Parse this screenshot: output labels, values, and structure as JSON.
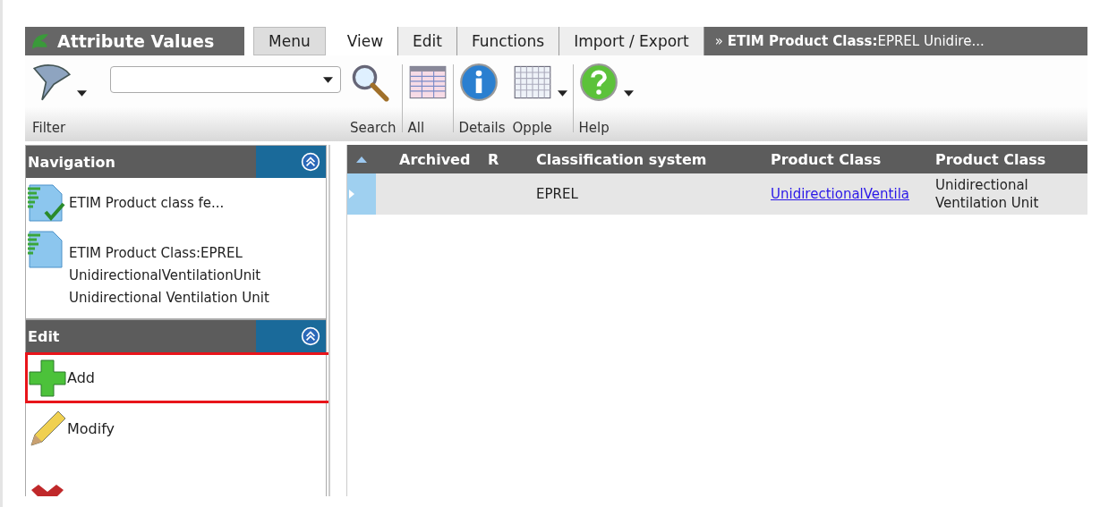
{
  "app_title": "Attribute Values",
  "tabs": [
    {
      "label": "Menu",
      "selected": false,
      "kind": "menu"
    },
    {
      "label": "View",
      "selected": true,
      "kind": "tab"
    },
    {
      "label": "Edit",
      "selected": false,
      "kind": "tab"
    },
    {
      "label": "Functions",
      "selected": false,
      "kind": "tab"
    },
    {
      "label": "Import / Export",
      "selected": false,
      "kind": "tab"
    }
  ],
  "breadcrumb": "» **ETIM Product Class:**EPREL Unidire...",
  "toolbar": [
    {
      "kind": "button",
      "label": "Filter",
      "dropdown": true
    },
    {
      "kind": "combo"
    },
    {
      "kind": "button",
      "label": "Search",
      "dropdown": false
    },
    {
      "kind": "button",
      "label": "All",
      "dropdown": false
    },
    {
      "kind": "button",
      "label": "Details",
      "dropdown": false
    },
    {
      "kind": "button",
      "label": "Opple",
      "dropdown": true
    },
    {
      "kind": "button",
      "label": "Help",
      "dropdown": true
    }
  ],
  "navigation": {
    "title": "Navigation",
    "expanded": true,
    "items": [
      {
        "lines": [
          "ETIM Product class fe..."
        ]
      },
      {
        "lines": [
          "ETIM Product Class:EPREL",
          "UnidirectionalVentilationUnit",
          "Unidirectional Ventilation Unit"
        ]
      }
    ]
  },
  "edit_panel": {
    "title": "Edit",
    "expanded": true,
    "items": [
      {
        "label": "Add",
        "highlighted": true
      },
      {
        "label": "Modify",
        "highlighted": false
      },
      {
        "highlighted": false
      }
    ]
  },
  "table": {
    "columns": [
      "Archived",
      "R",
      "Classification system",
      "Product Class",
      "Product Class"
    ],
    "rows": [
      {
        "selected": true,
        "cells": [
          {
            "kind": "text"
          },
          {
            "kind": "text"
          },
          {
            "text": "EPREL",
            "kind": "text"
          },
          {
            "text": "UnidirectionalVentila",
            "kind": "link"
          },
          {
            "text": "Unidirectional Ventilation Unit",
            "kind": "text"
          }
        ]
      }
    ]
  }
}
